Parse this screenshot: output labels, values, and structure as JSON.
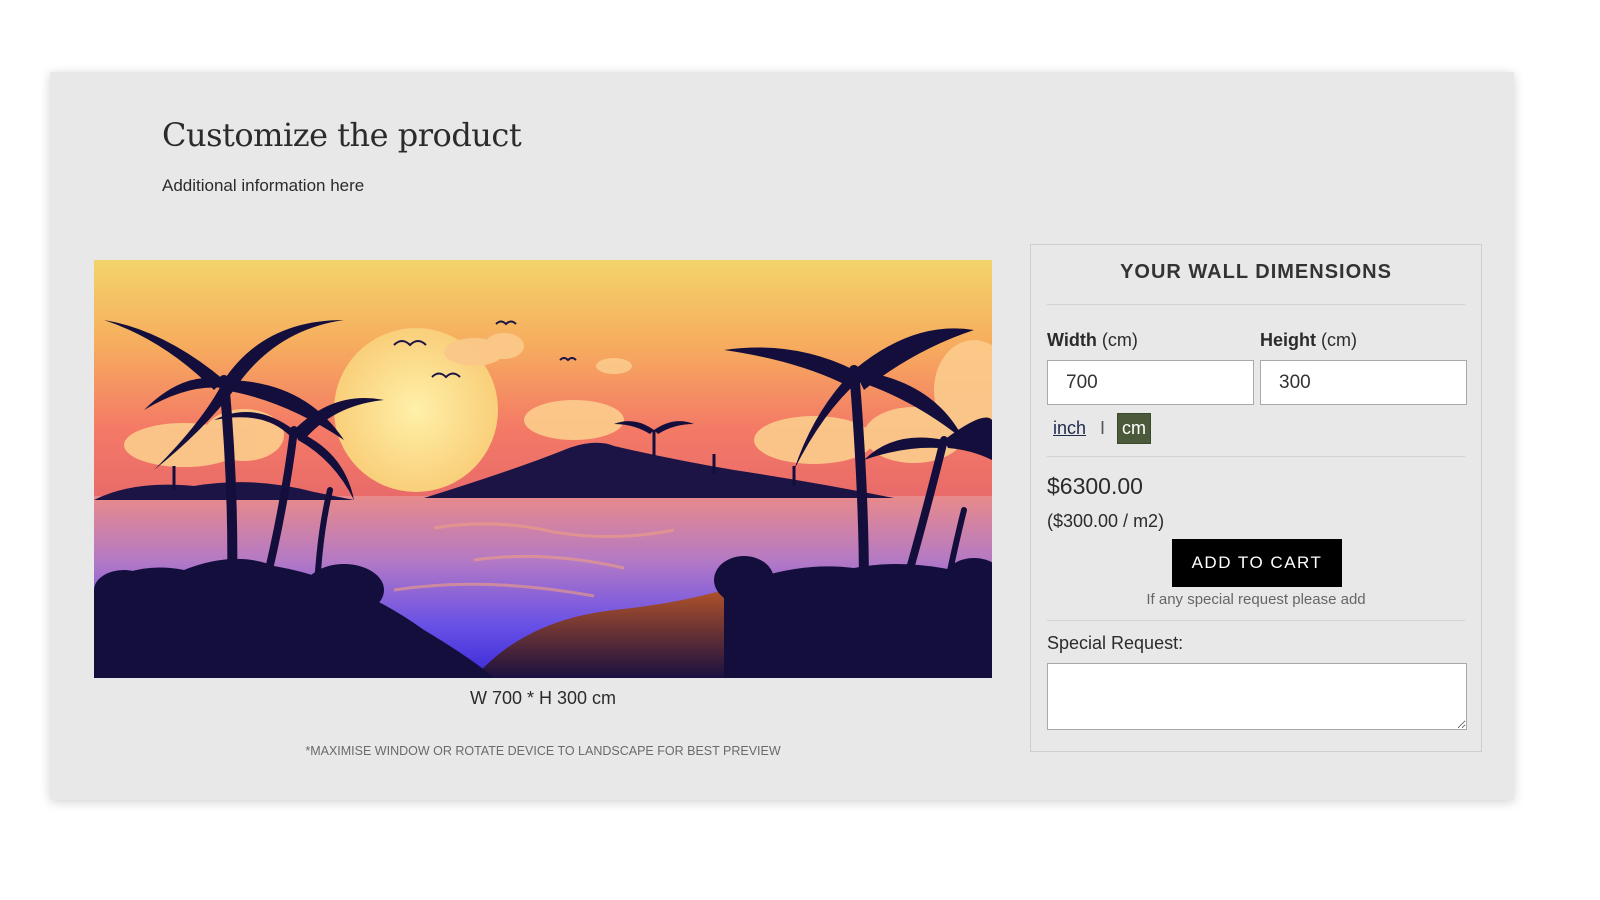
{
  "header": {
    "title": "Customize the product",
    "subtitle": "Additional information here"
  },
  "preview": {
    "caption": "W 700 * H 300 cm",
    "note": "*MAXIMISE WINDOW OR ROTATE DEVICE TO LANDSCAPE FOR BEST PREVIEW",
    "image_subject": "tropical-sunset-beach-mural"
  },
  "panel": {
    "title": "YOUR WALL DIMENSIONS",
    "width_label_bold": "Width",
    "width_label_unit": "(cm)",
    "height_label_bold": "Height",
    "height_label_unit": "(cm)",
    "width_value": "700",
    "height_value": "300",
    "unit_inch": "inch",
    "unit_separator": "I",
    "unit_cm": "cm",
    "selected_unit": "cm",
    "price": "$6300.00",
    "price_per_unit": "($300.00 / m2)",
    "add_to_cart": "ADD TO CART",
    "special_hint": "If any special request please add",
    "special_label": "Special Request:",
    "special_value": ""
  },
  "colors": {
    "card_bg": "#e8e8e8",
    "cart_button": "#000000",
    "unit_active": "#4a5a3a",
    "unit_link": "#1e2a4a"
  }
}
